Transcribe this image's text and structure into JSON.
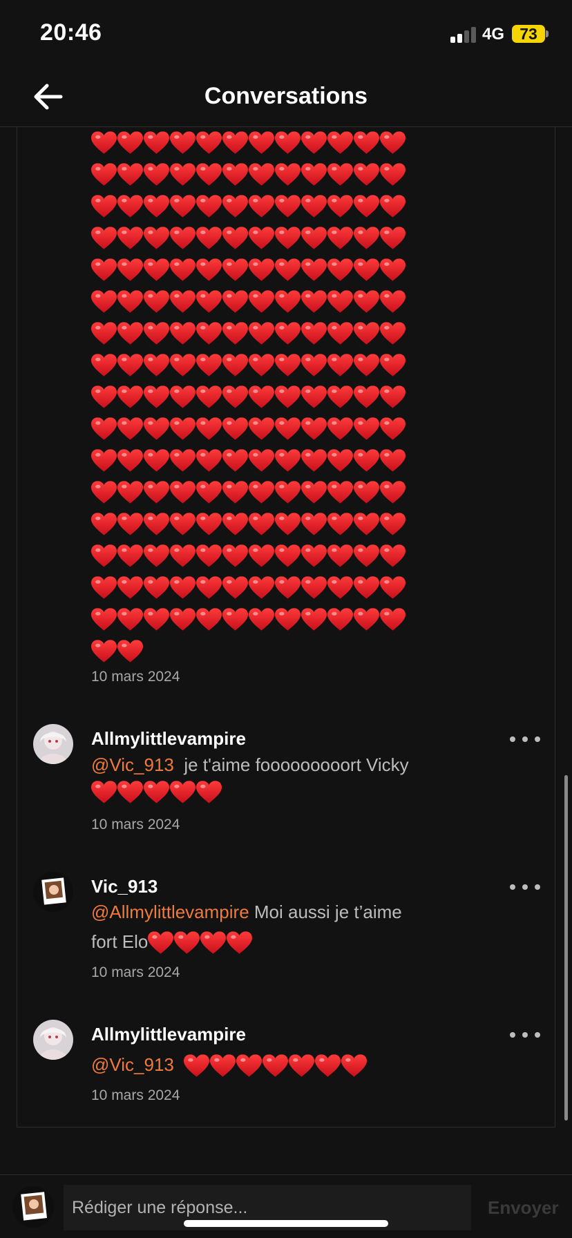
{
  "status_bar": {
    "time": "20:46",
    "network": "4G",
    "battery": "73"
  },
  "header": {
    "title": "Conversations"
  },
  "first_comment": {
    "heart_rows": [
      12,
      12,
      12,
      12,
      12,
      12,
      12,
      12,
      12,
      12,
      12,
      12,
      12,
      12,
      12,
      12,
      2
    ],
    "date": "10 mars 2024"
  },
  "comments": [
    {
      "author": "Allmylittlevampire",
      "mention": "@Vic_913",
      "text_line1": "je t'aime fooooooooort Vicky",
      "text_line2": "",
      "hearts": 5,
      "date": "10 mars 2024"
    },
    {
      "author": "Vic_913",
      "mention": "@Allmylittlevampire",
      "text_line1": "Moi aussi je t’aime",
      "text_line2": "fort Elo",
      "hearts": 4,
      "date": "10 mars 2024"
    },
    {
      "author": "Allmylittlevampire",
      "mention": "@Vic_913",
      "text_line1": "",
      "text_line2": "",
      "hearts": 7,
      "date": "10 mars 2024"
    }
  ],
  "reply_bar": {
    "placeholder": "Rédiger une réponse...",
    "send_label": "Envoyer"
  },
  "colors": {
    "background": "#121212",
    "mention": "#f07a3c",
    "battery": "#f5d400",
    "heart": "#e0242f"
  },
  "icons": [
    "back-arrow-icon",
    "more-icon",
    "heart-icon",
    "signal-icon",
    "battery-icon"
  ]
}
